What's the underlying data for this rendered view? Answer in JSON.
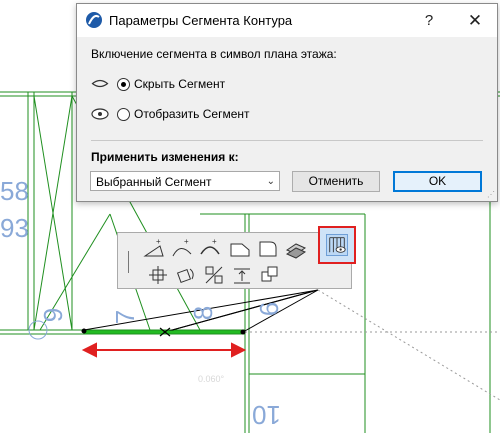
{
  "dialog": {
    "title": "Параметры Сегмента Контура",
    "help_label": "?",
    "close_label": "✕",
    "section_label": "Включение сегмента в символ плана этажа:",
    "options": [
      {
        "label": "Скрыть Сегмент",
        "selected": true
      },
      {
        "label": "Отобразить Сегмент",
        "selected": false
      }
    ],
    "apply_label": "Применить изменения к:",
    "apply_select": {
      "value": "Выбранный Сегмент"
    },
    "cancel_label": "Отменить",
    "ok_label": "OK"
  },
  "canvas": {
    "dimension_texts": [
      "58",
      "93",
      "9",
      "7",
      "8",
      "6",
      "10"
    ],
    "faded_text": "0.060°"
  },
  "palette": {
    "tools": [
      "add-node-icon",
      "arc-node-icon",
      "curve-node-icon",
      "offset-edge-icon",
      "fillet-icon",
      "offset-all-icon",
      "segment-visibility-icon",
      "move-icon",
      "rotate-icon",
      "mirror-icon",
      "elevate-icon",
      "multiply-icon"
    ],
    "selected_tool": "segment-visibility-icon"
  },
  "colors": {
    "accent": "#0078d7",
    "wall_lines": "#1f8f1f",
    "highlight_segment": "#22bb22",
    "arrow": "#e02020",
    "dimension_text": "#8aa9d8"
  }
}
